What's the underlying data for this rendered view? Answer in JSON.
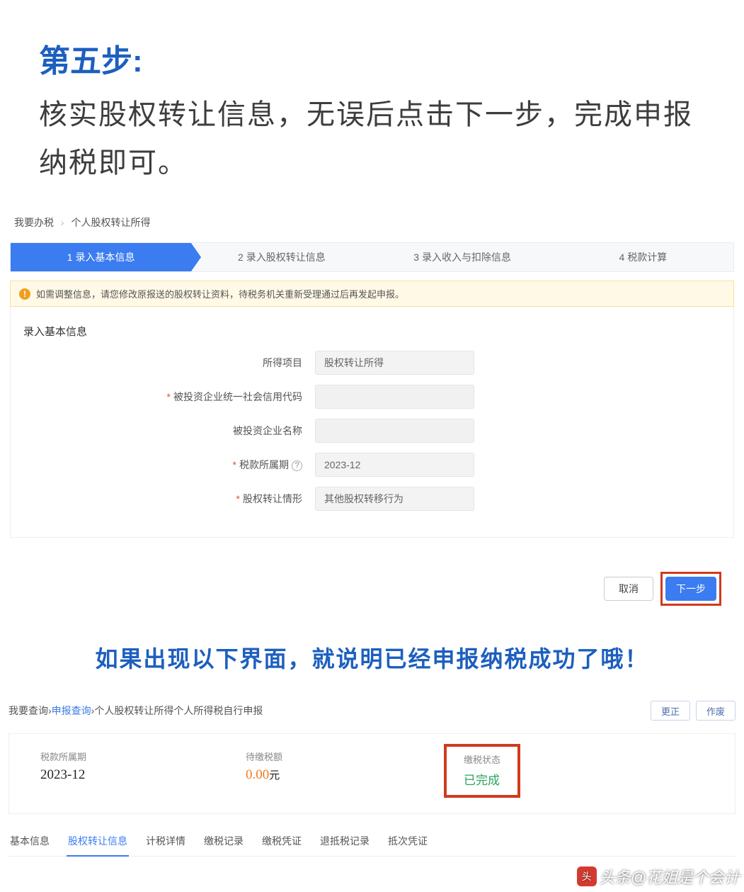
{
  "instruction": {
    "step_title": "第五步:",
    "step_desc": "核实股权转让信息，无误后点击下一步，完成申报纳税即可。"
  },
  "breadcrumb1": {
    "root": "我要办税",
    "current": "个人股权转让所得"
  },
  "steps": [
    "1  录入基本信息",
    "2  录入股权转让信息",
    "3  录入收入与扣除信息",
    "4  税款计算"
  ],
  "alert": "如需调整信息，请您修改原报送的股权转让资料，待税务机关重新受理通过后再发起申报。",
  "section_title": "录入基本信息",
  "form": {
    "f1_label": "所得项目",
    "f1_value": "股权转让所得",
    "f2_label": "被投资企业统一社会信用代码",
    "f3_label": "被投资企业名称",
    "f4_label": "税款所属期",
    "f4_value": "2023-12",
    "f5_label": "股权转让情形",
    "f5_value": "其他股权转移行为"
  },
  "buttons": {
    "cancel": "取消",
    "next": "下一步"
  },
  "success_msg": "如果出现以下界面，就说明已经申报纳税成功了哦！",
  "breadcrumb2": {
    "root": "我要查询",
    "link": "申报查询",
    "current": "个人股权转让所得个人所得税自行申报",
    "btn_correct": "更正",
    "btn_void": "作废"
  },
  "summary": {
    "period_label": "税款所属期",
    "period_value": "2023-12",
    "amount_label": "待缴税额",
    "amount_value": "0.00",
    "amount_unit": "元",
    "status_label": "缴税状态",
    "status_value": "已完成"
  },
  "tabs": [
    "基本信息",
    "股权转让信息",
    "计税详情",
    "缴税记录",
    "缴税凭证",
    "退抵税记录",
    "抵次凭证"
  ],
  "watermark": "头条@花姐是个会计"
}
